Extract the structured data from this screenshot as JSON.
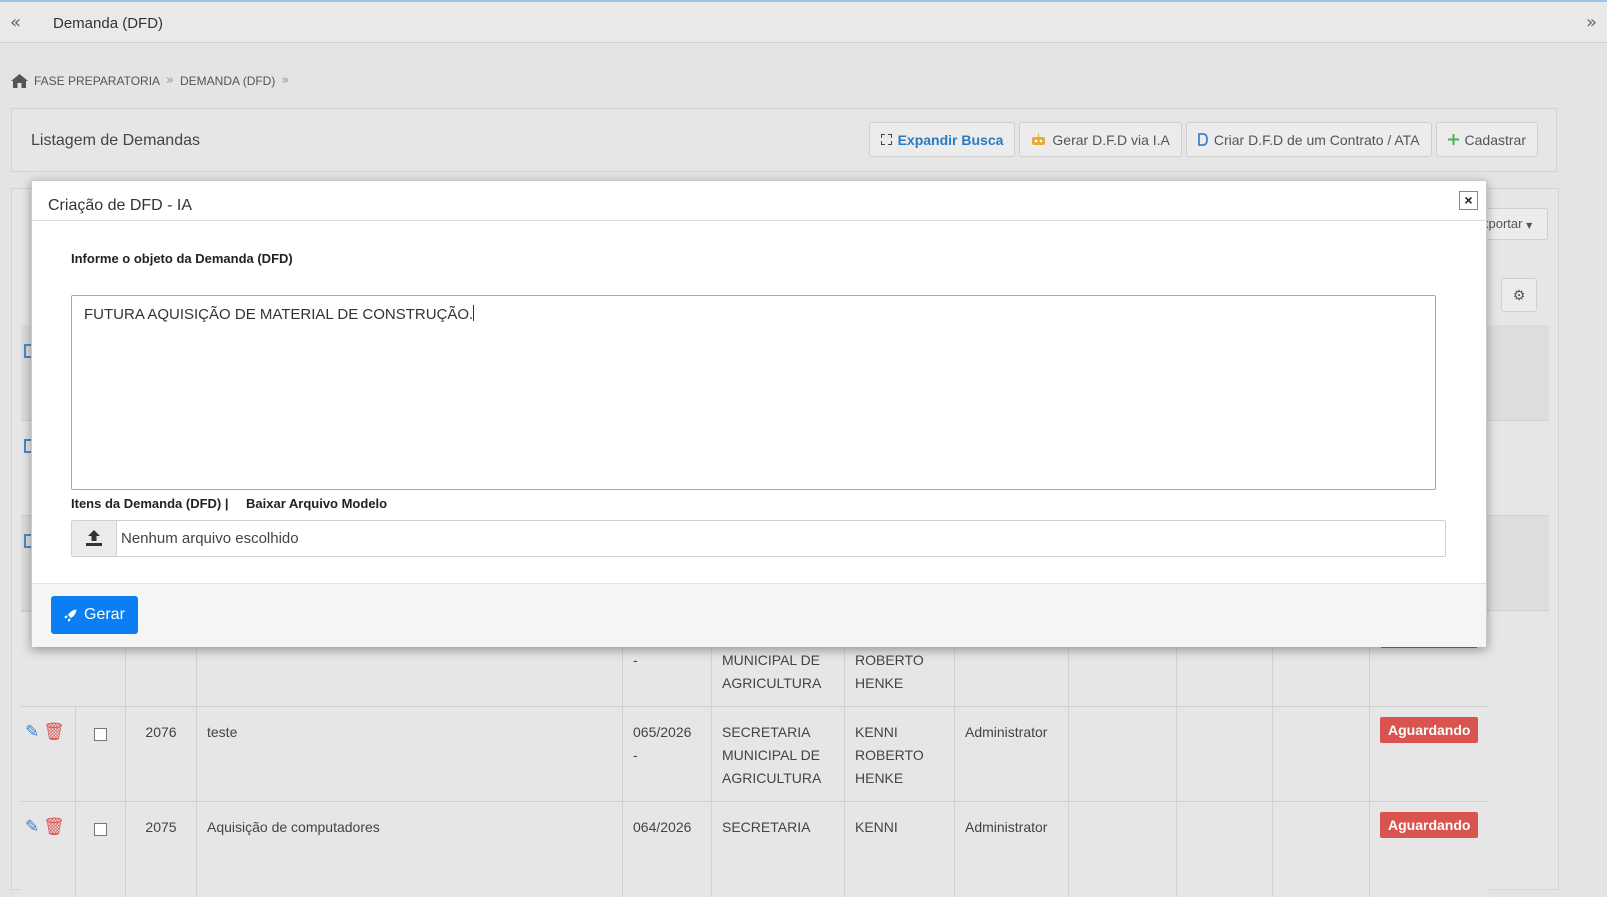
{
  "topbar": {
    "title": "Demanda (DFD)",
    "collapse_icon": "«",
    "expand_icon": "»"
  },
  "breadcrumb": {
    "item1": "FASE PREPARATORIA",
    "item2": "DEMANDA (DFD)",
    "sep": "»"
  },
  "panel": {
    "heading": "Listagem de Demandas",
    "btn_expandir": "Expandir Busca",
    "btn_gerar_ia": "Gerar D.F.D via I.A",
    "btn_criar_contrato": "Criar D.F.D de um Contrato / ATA",
    "btn_cadastrar": "Cadastrar"
  },
  "table": {
    "exportar": "xportar",
    "partial_row": {
      "col1": "-",
      "col2a": "MUNICIPAL DE",
      "col2b": "AGRICULTURA",
      "col3a": "ROBERTO",
      "col3b": "HENKE"
    },
    "rows": [
      {
        "id": "2076",
        "object": "teste",
        "number": "065/2026",
        "number2": "-",
        "secretaria": "SECRETARIA MUNICIPAL DE AGRICULTURA",
        "responsavel": "KENNI ROBERTO HENKE",
        "user": "Administrator",
        "status": "Aguardando"
      },
      {
        "id": "2075",
        "object": "Aquisição de computadores",
        "number": "064/2026",
        "number2": "",
        "secretaria": "SECRETARIA",
        "responsavel": "KENNI",
        "user": "Administrator",
        "status": "Aguardando"
      }
    ]
  },
  "modal": {
    "title": "Criação de DFD - IA",
    "close": "×",
    "object_label": "Informe o objeto da Demanda (DFD)",
    "object_value": "FUTURA AQUISIÇÃO DE MATERIAL DE CONSTRUÇÃO.",
    "items_label": "Itens da Demanda (DFD) |",
    "download_link": "Baixar Arquivo Modelo",
    "file_status": "Nenhum arquivo escolhido",
    "submit": "Gerar"
  },
  "colors": {
    "primary": "#0a7ef2",
    "danger": "#d9534f",
    "link": "#2a7ac3"
  }
}
